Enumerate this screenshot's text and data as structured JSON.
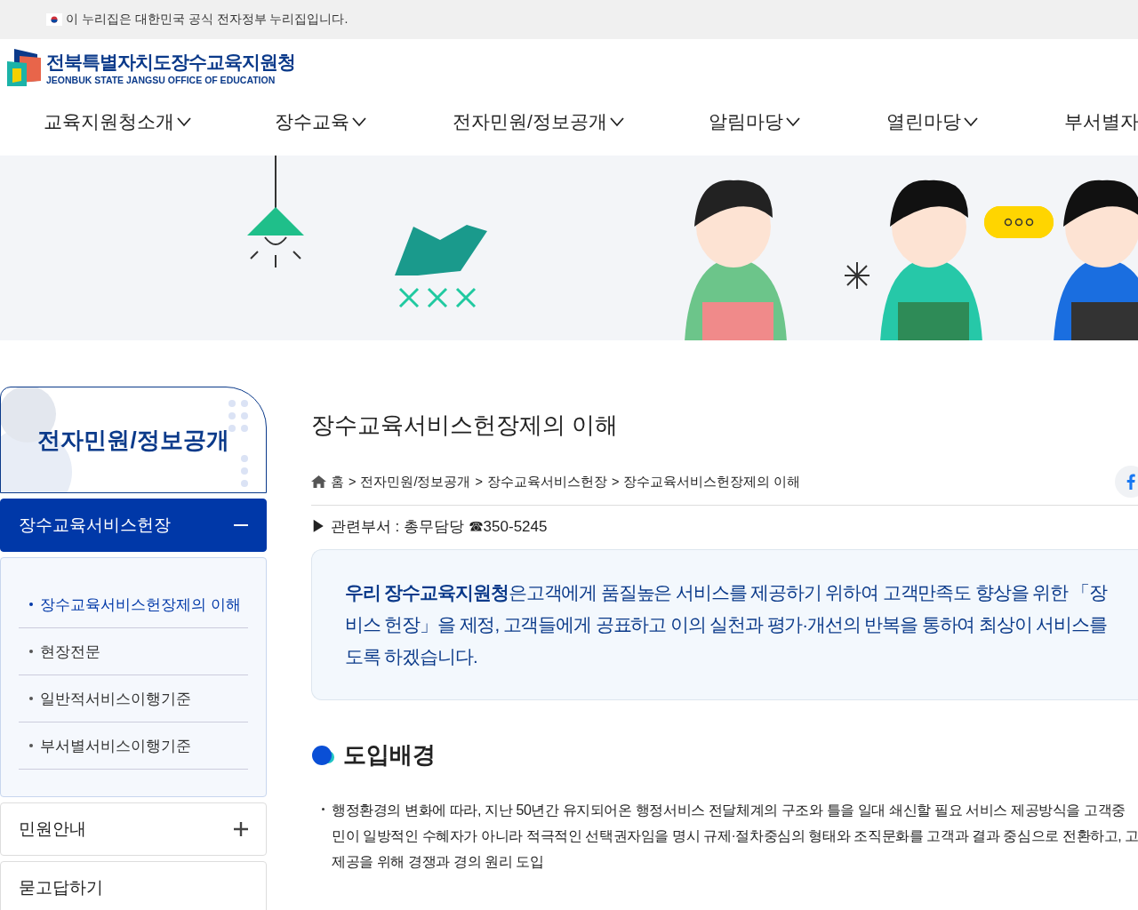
{
  "gov_banner": {
    "text": "이 누리집은 대한민국 공식 전자정부 누리집입니다."
  },
  "header": {
    "logo_title": "전북특별자치도장수교육지원청",
    "logo_subtitle": "JEONBUK STATE JANGSU OFFICE OF EDUCATION"
  },
  "nav": [
    {
      "label": "교육지원청소개"
    },
    {
      "label": "장수교육"
    },
    {
      "label": "전자민원/정보공개"
    },
    {
      "label": "알림마당"
    },
    {
      "label": "열린마당"
    },
    {
      "label": "부서별자"
    }
  ],
  "sidebar": {
    "title": "전자민원/정보공개",
    "sections": [
      {
        "label": "장수교육서비스헌장",
        "kind": "toggle",
        "expanded": true,
        "children": [
          {
            "label": "장수교육서비스헌장제의 이해",
            "selected": true
          },
          {
            "label": "현장전문",
            "selected": false
          },
          {
            "label": "일반적서비스이행기준",
            "selected": false
          },
          {
            "label": "부서별서비스이행기준",
            "selected": false
          }
        ]
      },
      {
        "label": "민원안내",
        "kind": "toggle",
        "expanded": false
      },
      {
        "label": "묻고답하기",
        "kind": "link"
      }
    ]
  },
  "content": {
    "title": "장수교육서비스헌장제의 이해",
    "breadcrumb": [
      "홈",
      "전자민원/정보공개",
      "장수교육서비스헌장",
      "장수교육서비스헌장제의 이해"
    ],
    "separator": ">",
    "related": "▶ 관련부서 : 총무담당 ☎350-5245",
    "callout_lines": [
      "**우리 장수교육지원청**은고객에게 품질높은 서비스를 제공하기 위하여 고객만족도 향상을 위한 「장",
      "비스 헌장」을 제정, 고객들에게 공표하고 이의 실천과 평가·개선의 반복을 통하여 최상이 서비스를",
      "도록 하겠습니다."
    ],
    "section_heading": "도입배경",
    "bullets": [
      {
        "lines": [
          "행정환경의 변화에 따라, 지난 50년간 유지되어온 행정서비스 전달체계의 구조와 틀을 일대 쇄신할 필요 서비스 제공방식을 고객중",
          "민이 일방적인 수혜자가 아니라 적극적인 선택권자임을 명시 규제·절차중심의 형태와 조직문화를 고객과 결과 중심으로 전환하고, 고",
          "제공을 위해 경쟁과 경의 원리 도입"
        ]
      }
    ]
  }
}
